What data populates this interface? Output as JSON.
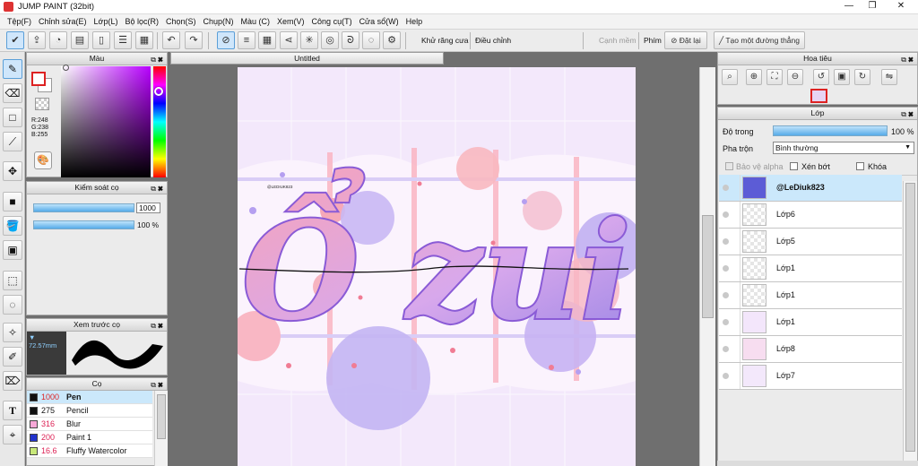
{
  "app": {
    "title": "JUMP PAINT (32bit)"
  },
  "menu": [
    "Tệp(F)",
    "Chỉnh sửa(E)",
    "Lớp(L)",
    "Bộ lọc(R)",
    "Chọn(S)",
    "Chụp(N)",
    "Màu (C)",
    "Xem(V)",
    "Công cụ(T)",
    "Cửa sổ(W)",
    "Help"
  ],
  "toolbar": {
    "antialias_label": "Khử răng cưa",
    "adjust_label": "Điều chỉnh",
    "adjust_value": "31",
    "smooth_label": "Cạnh mềm",
    "key_label": "Phím",
    "reset_label": "Đặt lại",
    "straight_label": "Tạo một đường thẳng"
  },
  "color_panel": {
    "title": "Màu",
    "r": "R:248",
    "g": "G:238",
    "b": "B:255",
    "fg_color": "#f8eeff"
  },
  "brush_control": {
    "title": "Kiểm soát cọ",
    "size": "1000",
    "opacity": "100 %"
  },
  "brush_preview": {
    "title": "Xem trước cọ",
    "size": "72.57mm"
  },
  "brush_list": {
    "title": "Cọ",
    "items": [
      {
        "size": "1000",
        "name": "Pen",
        "color": "#111111",
        "selected": true
      },
      {
        "size": "275",
        "name": "Pencil",
        "color": "#111111",
        "selected": false
      },
      {
        "size": "316",
        "name": "Blur",
        "color": "#f7a8d8",
        "selected": false
      },
      {
        "size": "200",
        "name": "Paint 1",
        "color": "#2233cc",
        "selected": false
      },
      {
        "size": "16.6",
        "name": "Fluffy Watercolor",
        "color": "#c8e87a",
        "selected": false
      }
    ]
  },
  "document": {
    "tab": "Untitled",
    "artwork_text": "Ổ zui",
    "stamp_text": "@LEDIUK823"
  },
  "navigator": {
    "title": "Hoa tiêu"
  },
  "layers": {
    "title": "Lớp",
    "opacity_label": "Độ trong",
    "opacity_value": "100 %",
    "blend_label": "Pha trộn",
    "blend_value": "Bình thường",
    "protect_alpha": "Bảo vệ alpha",
    "clip": "Xén bớt",
    "lock": "Khóa",
    "items": [
      {
        "name": "@LeDiuk823",
        "selected": true
      },
      {
        "name": "Lớp6",
        "selected": false
      },
      {
        "name": "Lớp5",
        "selected": false
      },
      {
        "name": "Lớp1",
        "selected": false
      },
      {
        "name": "Lớp1",
        "selected": false
      },
      {
        "name": "Lớp1",
        "selected": false
      },
      {
        "name": "Lớp8",
        "selected": false
      },
      {
        "name": "Lớp7",
        "selected": false
      }
    ]
  }
}
